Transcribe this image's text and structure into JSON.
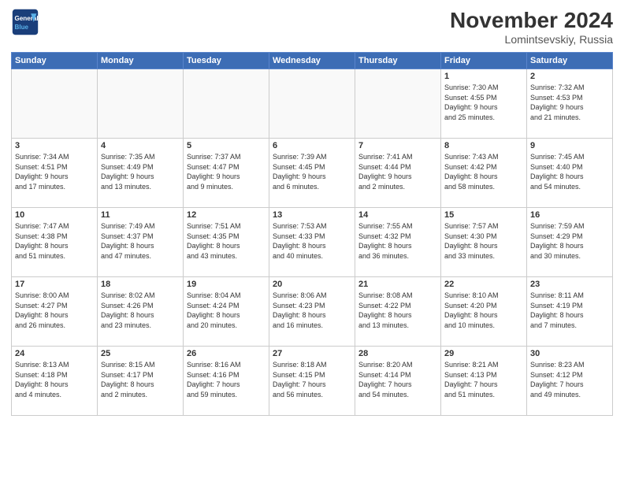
{
  "header": {
    "logo_line1": "General",
    "logo_line2": "Blue",
    "month_title": "November 2024",
    "location": "Lomintsevskiy, Russia"
  },
  "weekdays": [
    "Sunday",
    "Monday",
    "Tuesday",
    "Wednesday",
    "Thursday",
    "Friday",
    "Saturday"
  ],
  "weeks": [
    [
      {
        "day": "",
        "info": ""
      },
      {
        "day": "",
        "info": ""
      },
      {
        "day": "",
        "info": ""
      },
      {
        "day": "",
        "info": ""
      },
      {
        "day": "",
        "info": ""
      },
      {
        "day": "1",
        "info": "Sunrise: 7:30 AM\nSunset: 4:55 PM\nDaylight: 9 hours\nand 25 minutes."
      },
      {
        "day": "2",
        "info": "Sunrise: 7:32 AM\nSunset: 4:53 PM\nDaylight: 9 hours\nand 21 minutes."
      }
    ],
    [
      {
        "day": "3",
        "info": "Sunrise: 7:34 AM\nSunset: 4:51 PM\nDaylight: 9 hours\nand 17 minutes."
      },
      {
        "day": "4",
        "info": "Sunrise: 7:35 AM\nSunset: 4:49 PM\nDaylight: 9 hours\nand 13 minutes."
      },
      {
        "day": "5",
        "info": "Sunrise: 7:37 AM\nSunset: 4:47 PM\nDaylight: 9 hours\nand 9 minutes."
      },
      {
        "day": "6",
        "info": "Sunrise: 7:39 AM\nSunset: 4:45 PM\nDaylight: 9 hours\nand 6 minutes."
      },
      {
        "day": "7",
        "info": "Sunrise: 7:41 AM\nSunset: 4:44 PM\nDaylight: 9 hours\nand 2 minutes."
      },
      {
        "day": "8",
        "info": "Sunrise: 7:43 AM\nSunset: 4:42 PM\nDaylight: 8 hours\nand 58 minutes."
      },
      {
        "day": "9",
        "info": "Sunrise: 7:45 AM\nSunset: 4:40 PM\nDaylight: 8 hours\nand 54 minutes."
      }
    ],
    [
      {
        "day": "10",
        "info": "Sunrise: 7:47 AM\nSunset: 4:38 PM\nDaylight: 8 hours\nand 51 minutes."
      },
      {
        "day": "11",
        "info": "Sunrise: 7:49 AM\nSunset: 4:37 PM\nDaylight: 8 hours\nand 47 minutes."
      },
      {
        "day": "12",
        "info": "Sunrise: 7:51 AM\nSunset: 4:35 PM\nDaylight: 8 hours\nand 43 minutes."
      },
      {
        "day": "13",
        "info": "Sunrise: 7:53 AM\nSunset: 4:33 PM\nDaylight: 8 hours\nand 40 minutes."
      },
      {
        "day": "14",
        "info": "Sunrise: 7:55 AM\nSunset: 4:32 PM\nDaylight: 8 hours\nand 36 minutes."
      },
      {
        "day": "15",
        "info": "Sunrise: 7:57 AM\nSunset: 4:30 PM\nDaylight: 8 hours\nand 33 minutes."
      },
      {
        "day": "16",
        "info": "Sunrise: 7:59 AM\nSunset: 4:29 PM\nDaylight: 8 hours\nand 30 minutes."
      }
    ],
    [
      {
        "day": "17",
        "info": "Sunrise: 8:00 AM\nSunset: 4:27 PM\nDaylight: 8 hours\nand 26 minutes."
      },
      {
        "day": "18",
        "info": "Sunrise: 8:02 AM\nSunset: 4:26 PM\nDaylight: 8 hours\nand 23 minutes."
      },
      {
        "day": "19",
        "info": "Sunrise: 8:04 AM\nSunset: 4:24 PM\nDaylight: 8 hours\nand 20 minutes."
      },
      {
        "day": "20",
        "info": "Sunrise: 8:06 AM\nSunset: 4:23 PM\nDaylight: 8 hours\nand 16 minutes."
      },
      {
        "day": "21",
        "info": "Sunrise: 8:08 AM\nSunset: 4:22 PM\nDaylight: 8 hours\nand 13 minutes."
      },
      {
        "day": "22",
        "info": "Sunrise: 8:10 AM\nSunset: 4:20 PM\nDaylight: 8 hours\nand 10 minutes."
      },
      {
        "day": "23",
        "info": "Sunrise: 8:11 AM\nSunset: 4:19 PM\nDaylight: 8 hours\nand 7 minutes."
      }
    ],
    [
      {
        "day": "24",
        "info": "Sunrise: 8:13 AM\nSunset: 4:18 PM\nDaylight: 8 hours\nand 4 minutes."
      },
      {
        "day": "25",
        "info": "Sunrise: 8:15 AM\nSunset: 4:17 PM\nDaylight: 8 hours\nand 2 minutes."
      },
      {
        "day": "26",
        "info": "Sunrise: 8:16 AM\nSunset: 4:16 PM\nDaylight: 7 hours\nand 59 minutes."
      },
      {
        "day": "27",
        "info": "Sunrise: 8:18 AM\nSunset: 4:15 PM\nDaylight: 7 hours\nand 56 minutes."
      },
      {
        "day": "28",
        "info": "Sunrise: 8:20 AM\nSunset: 4:14 PM\nDaylight: 7 hours\nand 54 minutes."
      },
      {
        "day": "29",
        "info": "Sunrise: 8:21 AM\nSunset: 4:13 PM\nDaylight: 7 hours\nand 51 minutes."
      },
      {
        "day": "30",
        "info": "Sunrise: 8:23 AM\nSunset: 4:12 PM\nDaylight: 7 hours\nand 49 minutes."
      }
    ]
  ]
}
